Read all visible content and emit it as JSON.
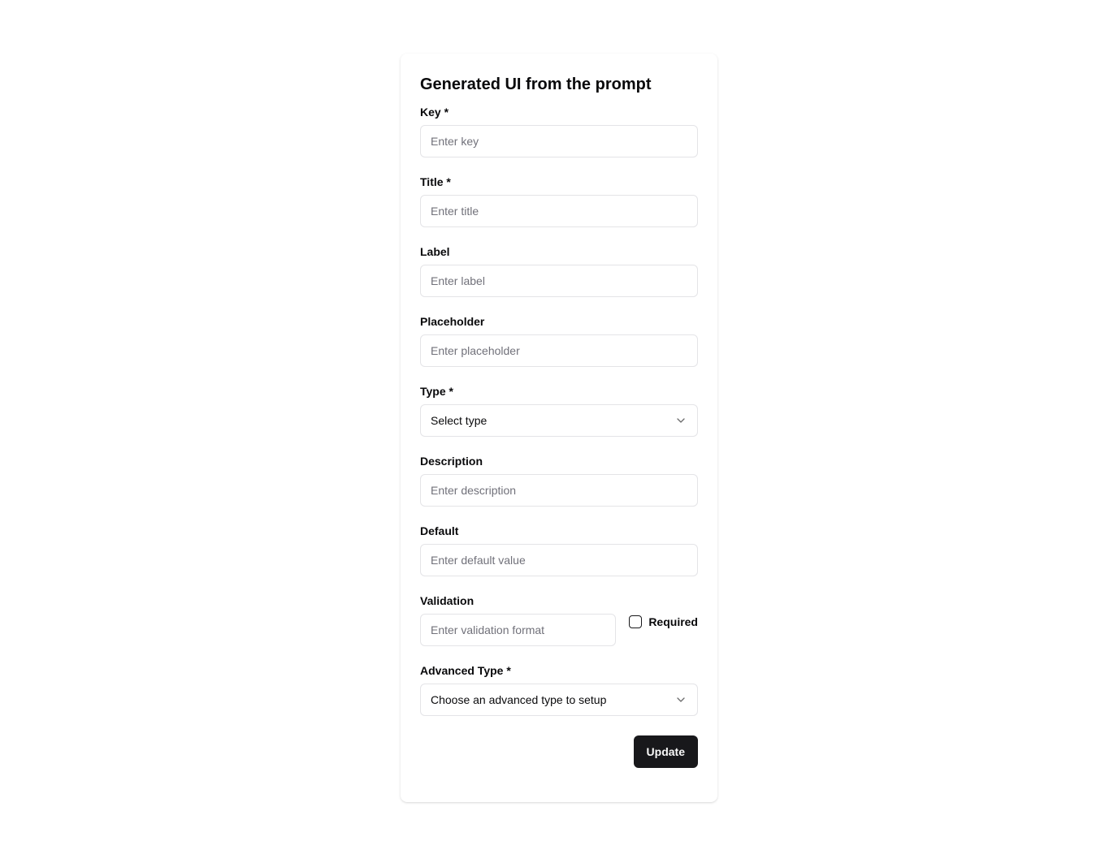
{
  "form": {
    "title": "Generated UI from the prompt",
    "key": {
      "label": "Key *",
      "placeholder": "Enter key",
      "value": ""
    },
    "title_field": {
      "label": "Title *",
      "placeholder": "Enter title",
      "value": ""
    },
    "label_field": {
      "label": "Label",
      "placeholder": "Enter label",
      "value": ""
    },
    "placeholder_field": {
      "label": "Placeholder",
      "placeholder": "Enter placeholder",
      "value": ""
    },
    "type": {
      "label": "Type *",
      "selected": "Select type"
    },
    "description": {
      "label": "Description",
      "placeholder": "Enter description",
      "value": ""
    },
    "default": {
      "label": "Default",
      "placeholder": "Enter default value",
      "value": ""
    },
    "validation": {
      "label": "Validation",
      "placeholder": "Enter validation format",
      "value": ""
    },
    "required": {
      "label": "Required",
      "checked": false
    },
    "advanced_type": {
      "label": "Advanced Type *",
      "selected": "Choose an advanced type to setup"
    },
    "submit_label": "Update"
  },
  "icons": {
    "select_chevron": "chevron-down-icon",
    "advanced_chevron": "chevron-down-icon"
  },
  "colors": {
    "primary_button": "#18181b",
    "border": "#e4e4e7",
    "placeholder_text": "#71717a"
  }
}
